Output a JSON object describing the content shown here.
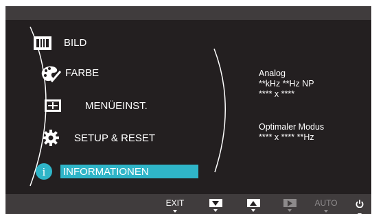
{
  "menu": {
    "items": [
      {
        "label": "BILD",
        "icon": "picture-icon"
      },
      {
        "label": "FARBE",
        "icon": "palette-icon"
      },
      {
        "label": "MENÜEINST.",
        "icon": "menu-settings-icon"
      },
      {
        "label": "SETUP & RESET",
        "icon": "gear-icon"
      },
      {
        "label": "INFORMATIONEN",
        "icon": "info-icon",
        "selected": true
      }
    ]
  },
  "info": {
    "signal_type": "Analog",
    "frequency": "**kHz **Hz NP",
    "resolution": "**** x ****",
    "optimal_mode_label": "Optimaler Modus",
    "optimal_mode_value": "**** x **** **Hz"
  },
  "buttons": {
    "exit": "EXIT",
    "down_icon": "down-arrow-icon",
    "up_icon": "up-arrow-icon",
    "enter_icon": "play-icon",
    "auto": "AUTO",
    "power_icon": "power-icon"
  },
  "colors": {
    "background": "#231f20",
    "bars": "#403c3d",
    "highlight": "#2fb5c8",
    "disabled": "#8d8a8b"
  }
}
